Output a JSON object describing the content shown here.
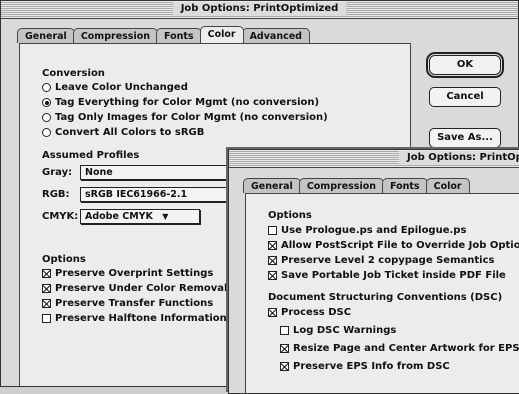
{
  "back_window": {
    "title": "Job Options: PrintOptimized",
    "tabs": [
      "General",
      "Compression",
      "Fonts",
      "Color",
      "Advanced"
    ],
    "active_tab": "Color",
    "conversion": {
      "label": "Conversion",
      "options": [
        {
          "label": "Leave Color Unchanged",
          "selected": false
        },
        {
          "label": "Tag Everything for Color Mgmt (no conversion)",
          "selected": true
        },
        {
          "label": "Tag Only Images for Color Mgmt (no conversion)",
          "selected": false
        },
        {
          "label": "Convert All Colors to sRGB",
          "selected": false
        }
      ]
    },
    "assumed_profiles": {
      "label": "Assumed Profiles",
      "gray_label": "Gray:",
      "gray_value": "None",
      "rgb_label": "RGB:",
      "rgb_value": "sRGB IEC61966-2.1",
      "cmyk_label": "CMYK:",
      "cmyk_value": "Adobe CMYK"
    },
    "options": {
      "label": "Options",
      "items": [
        {
          "label": "Preserve Overprint Settings",
          "checked": true
        },
        {
          "label": "Preserve Under Color Removal",
          "checked": true
        },
        {
          "label": "Preserve Transfer Functions",
          "checked": true
        },
        {
          "label": "Preserve Halftone Information",
          "checked": false
        }
      ]
    },
    "buttons": {
      "ok": "OK",
      "cancel": "Cancel",
      "save_as": "Save As..."
    }
  },
  "front_window": {
    "title": "Job Options: PrintOptimized",
    "tabs": [
      "General",
      "Compression",
      "Fonts",
      "Color"
    ],
    "options": {
      "label": "Options",
      "items": [
        {
          "label": "Use Prologue.ps and Epilogue.ps",
          "checked": false
        },
        {
          "label": "Allow PostScript File to Override Job Options",
          "checked": true
        },
        {
          "label": "Preserve Level 2 copypage Semantics",
          "checked": true
        },
        {
          "label": "Save Portable Job Ticket inside PDF File",
          "checked": true
        }
      ]
    },
    "dsc": {
      "label": "Document Structuring Conventions (DSC)",
      "process_dsc": {
        "label": "Process DSC",
        "checked": true
      },
      "items": [
        {
          "label": "Log DSC Warnings",
          "checked": false
        },
        {
          "label": "Resize Page and Center Artwork for EPS Files",
          "checked": true
        },
        {
          "label": "Preserve EPS Info from DSC",
          "checked": true
        }
      ]
    }
  }
}
